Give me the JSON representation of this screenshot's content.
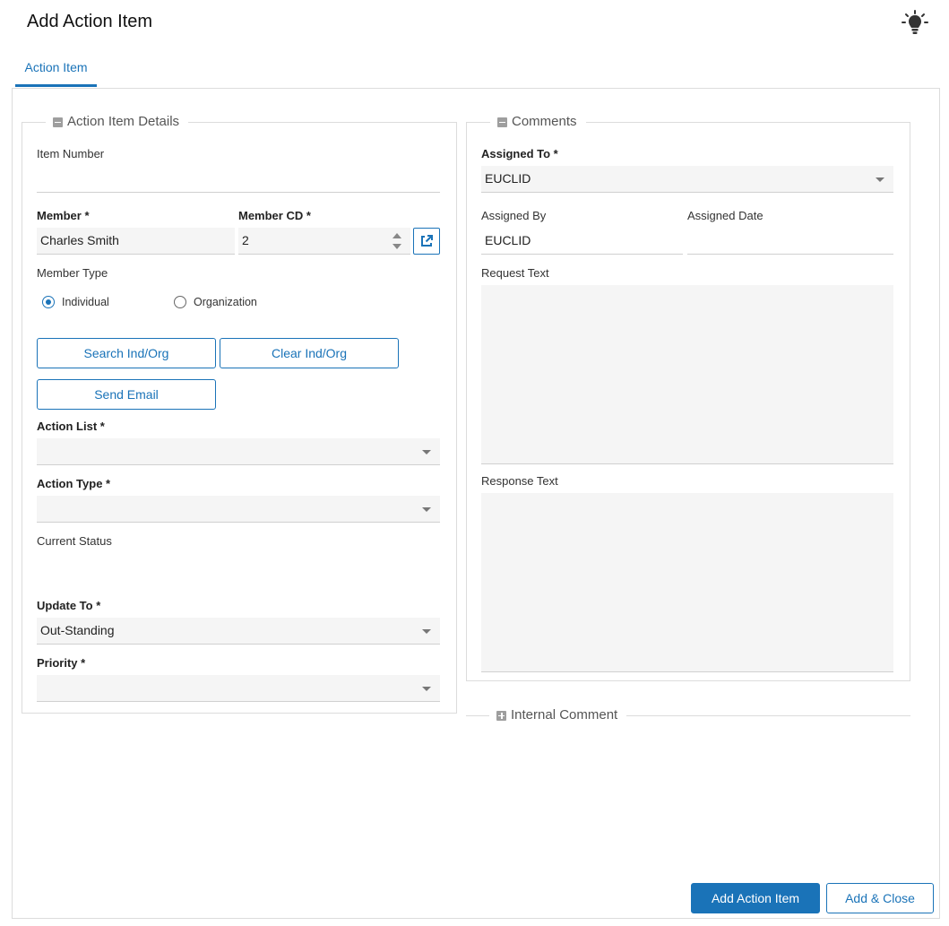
{
  "page": {
    "title": "Add Action Item"
  },
  "tabs": [
    {
      "label": "Action Item",
      "active": true
    }
  ],
  "colors": {
    "accent": "#1a73b8",
    "field_bg": "#f5f5f5",
    "border": "#dcdcdc"
  },
  "details": {
    "legend": "Action Item Details",
    "item_number": {
      "label": "Item Number",
      "value": ""
    },
    "member": {
      "label": "Member *",
      "value": "Charles Smith"
    },
    "member_cd": {
      "label": "Member CD *",
      "value": "2"
    },
    "member_type": {
      "label": "Member Type",
      "options": [
        "Individual",
        "Organization"
      ],
      "selected": "Individual"
    },
    "buttons": {
      "search": "Search Ind/Org",
      "clear": "Clear Ind/Org",
      "send_email": "Send Email"
    },
    "action_list": {
      "label": "Action List *",
      "value": ""
    },
    "action_type": {
      "label": "Action Type *",
      "value": ""
    },
    "current_status": {
      "label": "Current Status",
      "value": ""
    },
    "update_to": {
      "label": "Update To *",
      "value": "Out-Standing"
    },
    "priority": {
      "label": "Priority *",
      "value": ""
    }
  },
  "comments": {
    "legend": "Comments",
    "assigned_to": {
      "label": "Assigned To *",
      "value": "EUCLID"
    },
    "assigned_by": {
      "label": "Assigned By",
      "value": "EUCLID"
    },
    "assigned_date": {
      "label": "Assigned Date",
      "value": ""
    },
    "request_text": {
      "label": "Request Text",
      "value": ""
    },
    "response_text": {
      "label": "Response Text",
      "value": ""
    }
  },
  "internal_comment": {
    "legend": "Internal Comment",
    "collapsed": true
  },
  "footer": {
    "add": "Add Action Item",
    "add_close": "Add & Close"
  },
  "icons": {
    "help": "lightbulb-icon",
    "external": "external-link-icon"
  }
}
